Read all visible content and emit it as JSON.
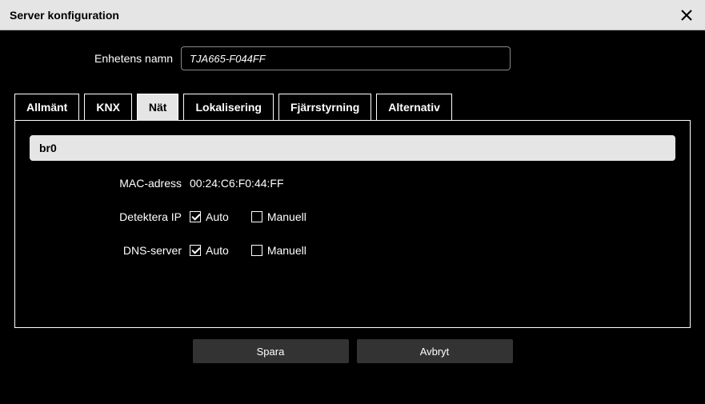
{
  "header": {
    "title": "Server konfiguration"
  },
  "device": {
    "label": "Enhetens namn",
    "value": "TJA665-F044FF"
  },
  "tabs": {
    "items": [
      {
        "label": "Allmänt"
      },
      {
        "label": "KNX"
      },
      {
        "label": "Nät"
      },
      {
        "label": "Lokalisering"
      },
      {
        "label": "Fjärrstyrning"
      },
      {
        "label": "Alternativ"
      }
    ],
    "active_index": 2
  },
  "network": {
    "interface": "br0",
    "mac_label": "MAC-adress",
    "mac_value": "00:24:C6:F0:44:FF",
    "detect_ip_label": "Detektera IP",
    "dns_server_label": "DNS-server",
    "option_auto": "Auto",
    "option_manual": "Manuell",
    "detect_ip": "auto",
    "dns_server": "auto"
  },
  "buttons": {
    "save": "Spara",
    "cancel": "Avbryt"
  }
}
